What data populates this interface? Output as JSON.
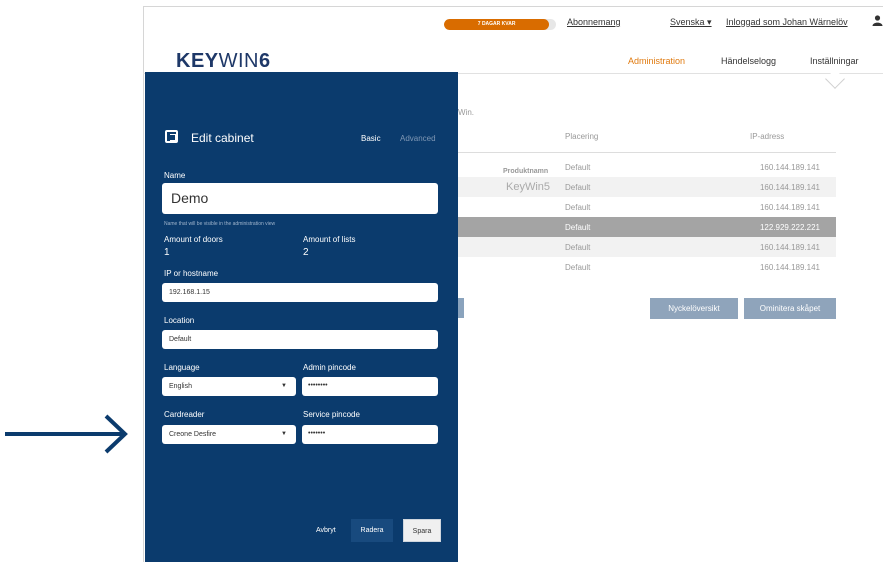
{
  "header": {
    "trial_badge": "7 DAGAR KVAR",
    "trial_progress": 0.94,
    "subscription_link": "Abonnemang",
    "language": "Svenska ▾",
    "logged_in": "Inloggad som Johan Wärnelöv",
    "user_icon": "user-icon"
  },
  "logo": {
    "bold": "KEY",
    "thin": "WIN",
    "digit": "6"
  },
  "nav": {
    "items": [
      "Administration",
      "Händelselogg",
      "Inställningar"
    ],
    "active": "Administration",
    "accent_color": "#e07a0f"
  },
  "background_table": {
    "fragment": "Win.",
    "headers": [
      "Placering",
      "IP-adress"
    ],
    "product_label": "Produktnamn",
    "product_value": "KeyWin5",
    "rows": [
      {
        "location": "Default",
        "ip": "160.144.189.141"
      },
      {
        "location": "Default",
        "ip": "160.144.189.141"
      },
      {
        "location": "Default",
        "ip": "160.144.189.141"
      },
      {
        "location": "Default",
        "ip": "122.929.222.221"
      },
      {
        "location": "Default",
        "ip": "160.144.189.141"
      },
      {
        "location": "Default",
        "ip": "160.144.189.141"
      }
    ],
    "selected_row": 3,
    "buttons": [
      "Nyckelöversikt",
      "Ominitera skåpet"
    ]
  },
  "modal": {
    "title": "Edit cabinet",
    "title_icon": "cabinet-icon",
    "tabs": [
      "Basic",
      "Advanced"
    ],
    "active_tab": "Basic",
    "name_label": "Name",
    "name_value": "Demo",
    "name_help": "Name that will be visible in the administration view",
    "doors_label": "Amount of doors",
    "doors_value": "1",
    "lists_label": "Amount of lists",
    "lists_value": "2",
    "ip_label": "IP or hostname",
    "ip_value": "192.168.1.15",
    "location_label": "Location",
    "location_value": "Default",
    "language_label": "Language",
    "language_value": "English",
    "admin_pin_label": "Admin pincode",
    "admin_pin_value": "••••••••",
    "cardreader_label": "Cardreader",
    "cardreader_value": "Creone Desfire",
    "service_pin_label": "Service pincode",
    "service_pin_value": "•••••••",
    "cancel": "Avbryt",
    "delete": "Radera",
    "save": "Spara",
    "background_color": "#0b3b6d"
  },
  "annotation": {
    "arrow_icon": "right-arrow-icon",
    "color": "#0b3b6d"
  }
}
